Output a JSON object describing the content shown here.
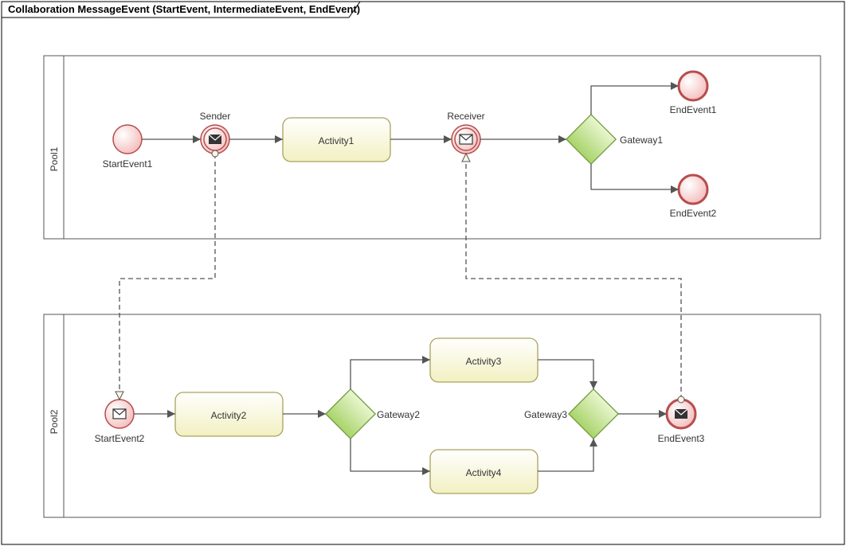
{
  "title": "Collaboration MessageEvent (StartEvent, IntermediateEvent, EndEvent)",
  "pool1": {
    "label": "Pool1"
  },
  "pool2": {
    "label": "Pool2"
  },
  "events": {
    "startEvent1": "StartEvent1",
    "sender": "Sender",
    "receiver": "Receiver",
    "gateway1": "Gateway1",
    "endEvent1": "EndEvent1",
    "endEvent2": "EndEvent2",
    "startEvent2": "StartEvent2",
    "gateway2": "Gateway2",
    "gateway3": "Gateway3",
    "endEvent3": "EndEvent3"
  },
  "activities": {
    "activity1": "Activity1",
    "activity2": "Activity2",
    "activity3": "Activity3",
    "activity4": "Activity4"
  }
}
